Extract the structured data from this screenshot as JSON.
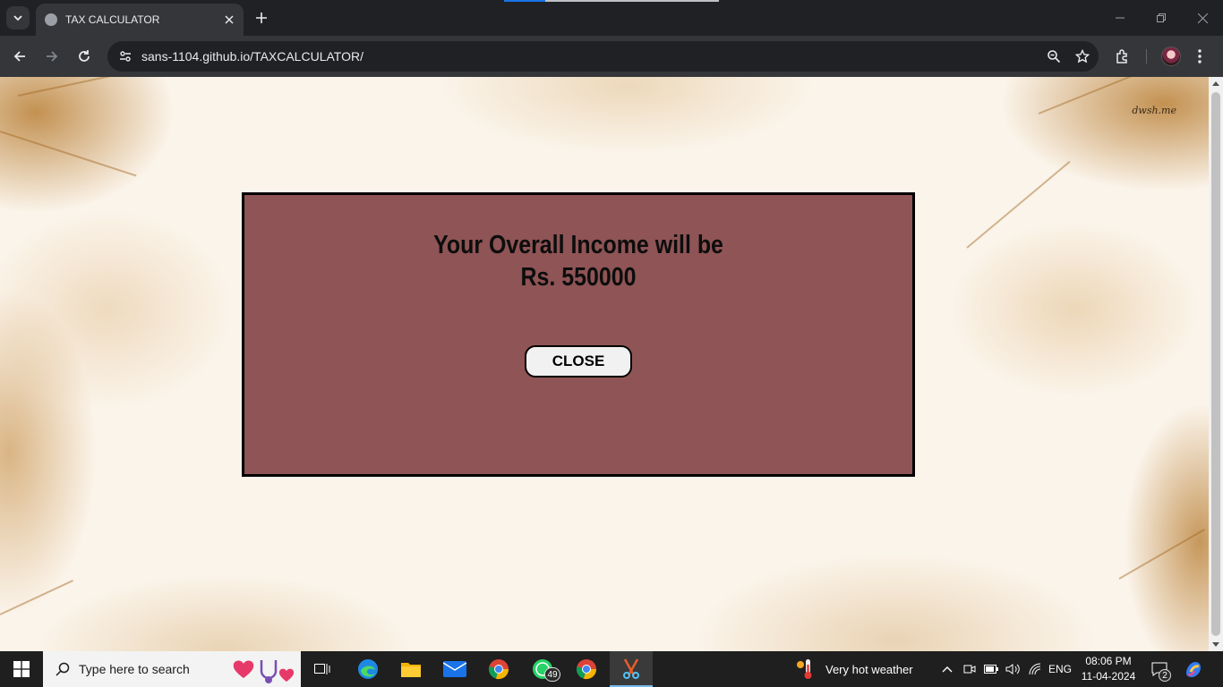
{
  "browser": {
    "tab_title": "TAX CALCULATOR",
    "url": "sans-1104.github.io/TAXCALCULATOR/"
  },
  "page": {
    "watermark": "dwsh.me",
    "modal": {
      "line1": "Your Overall Income will be",
      "line2": "Rs. 550000",
      "close_label": "CLOSE"
    },
    "colors": {
      "modal_bg": "#8f5455",
      "background": "#fbf4ea"
    }
  },
  "taskbar": {
    "search_placeholder": "Type here to search",
    "whatsapp_badge": "49",
    "weather": "Very hot weather",
    "language": "ENG",
    "time": "08:06 PM",
    "date": "11-04-2024",
    "notifications": "2"
  }
}
